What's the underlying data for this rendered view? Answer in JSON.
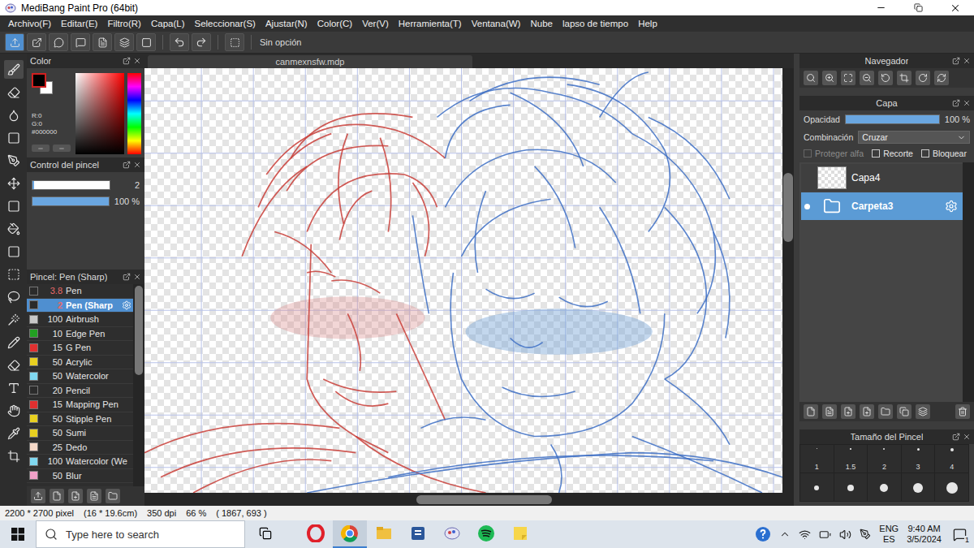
{
  "window": {
    "title": "MediBang Paint Pro (64bit)"
  },
  "menu": [
    "Archivo(F)",
    "Editar(E)",
    "Filtro(R)",
    "Capa(L)",
    "Seleccionar(S)",
    "Ajustar(N)",
    "Color(C)",
    "Ver(V)",
    "Herramienta(T)",
    "Ventana(W)",
    "Nube",
    "lapso de tiempo",
    "Help"
  ],
  "toolbar": {
    "option": "Sin opción"
  },
  "color_panel": {
    "title": "Color",
    "readings": [
      "R:0",
      "G:0",
      "#000000"
    ]
  },
  "brush_control": {
    "title": "Control del pincel",
    "size": "2",
    "size_level": 0.02,
    "opacity": "100 %",
    "opacity_level": 1
  },
  "brushes": {
    "title": "Pincel: Pen (Sharp)",
    "items": [
      {
        "size": "3.8",
        "name": "Pen",
        "color": "#2b2b2b",
        "modified": true,
        "selected": false
      },
      {
        "size": "2",
        "name": "Pen (Sharp",
        "color": "#2b2b2b",
        "modified": true,
        "selected": true
      },
      {
        "size": "100",
        "name": "Airbrush",
        "color": "#c8c8c8",
        "modified": false,
        "selected": false
      },
      {
        "size": "10",
        "name": "Edge Pen",
        "color": "#22a022",
        "modified": false,
        "selected": false
      },
      {
        "size": "15",
        "name": "G Pen",
        "color": "#e03030",
        "modified": false,
        "selected": false
      },
      {
        "size": "50",
        "name": "Acrylic",
        "color": "#e8d020",
        "modified": false,
        "selected": false
      },
      {
        "size": "50",
        "name": "Watercolor",
        "color": "#80d8f0",
        "modified": false,
        "selected": false
      },
      {
        "size": "20",
        "name": "Pencil",
        "color": "#2b2b2b",
        "modified": false,
        "selected": false
      },
      {
        "size": "15",
        "name": "Mapping Pen",
        "color": "#e03030",
        "modified": false,
        "selected": false
      },
      {
        "size": "50",
        "name": "Stipple Pen",
        "color": "#e8d020",
        "modified": false,
        "selected": false
      },
      {
        "size": "50",
        "name": "Sumi",
        "color": "#e8d020",
        "modified": false,
        "selected": false
      },
      {
        "size": "25",
        "name": "Dedo",
        "color": "#f5d8c8",
        "modified": false,
        "selected": false
      },
      {
        "size": "100",
        "name": "Watercolor (We",
        "color": "#80d8f0",
        "modified": false,
        "selected": false
      },
      {
        "size": "50",
        "name": "Blur",
        "color": "#f0a0c8",
        "modified": false,
        "selected": false
      }
    ]
  },
  "canvas": {
    "tab": "canmexnsfw.mdp"
  },
  "navigator": {
    "title": "Navegador"
  },
  "layers": {
    "title": "Capa",
    "opacity_label": "Opacidad",
    "opacity": "100 %",
    "opacity_level": 1,
    "blend_label": "Combinación",
    "blend": "Cruzar",
    "options": [
      {
        "label": "Proteger alfa",
        "checked": false,
        "disabled": true
      },
      {
        "label": "Recorte",
        "checked": false,
        "disabled": false
      },
      {
        "label": "Bloquear",
        "checked": false,
        "disabled": false
      }
    ],
    "items": [
      {
        "name": "Capa4",
        "kind": "layer",
        "selected": false,
        "visible": false
      },
      {
        "name": "Carpeta3",
        "kind": "folder",
        "selected": true,
        "visible": true
      }
    ]
  },
  "brush_size": {
    "title": "Tamaño del Pincel",
    "sizes": [
      "1",
      "1.5",
      "2",
      "3",
      "4"
    ]
  },
  "status_bar": [
    "2200 * 2700 pixel",
    "(16 * 19.6cm)",
    "350 dpi",
    "66 %",
    "( 1867, 693 )"
  ],
  "taskbar": {
    "search": "Type here to search",
    "apps": [
      {
        "kind": "opera",
        "selected": false
      },
      {
        "kind": "chrome",
        "selected": true
      },
      {
        "kind": "explorer",
        "selected": false
      },
      {
        "kind": "word",
        "selected": false
      },
      {
        "kind": "medibang",
        "selected": false
      },
      {
        "kind": "spotify",
        "selected": false
      },
      {
        "kind": "notes",
        "selected": false
      }
    ]
  },
  "tray": {
    "language": "ENG",
    "layout": "ES",
    "time": "9:40 AM",
    "date": "3/5/2024",
    "notifications": "1"
  }
}
